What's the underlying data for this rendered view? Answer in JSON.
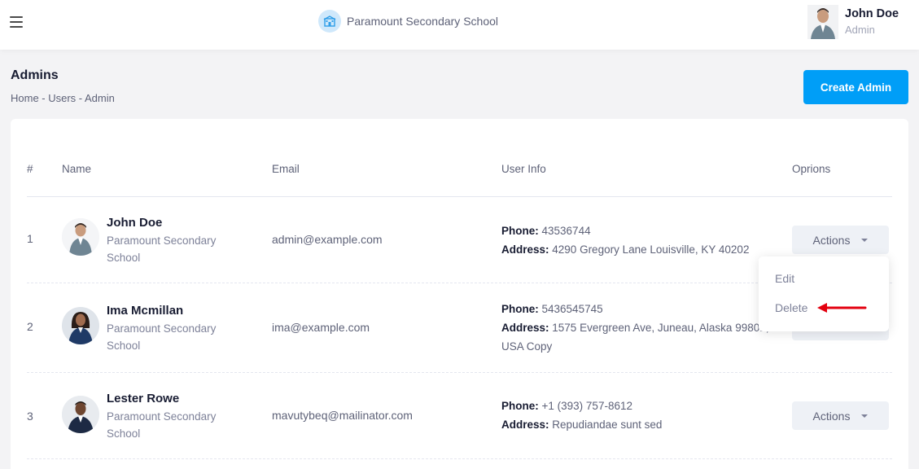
{
  "header": {
    "brand_name": "Paramount Secondary School",
    "user_name": "John Doe",
    "user_role": "Admin"
  },
  "page": {
    "title": "Admins",
    "breadcrumb": "Home - Users - Admin",
    "create_button": "Create Admin"
  },
  "table": {
    "headers": [
      "#",
      "Name",
      "Email",
      "User Info",
      "Oprions"
    ],
    "phone_label": "Phone:",
    "address_label": "Address:",
    "actions_label": "Actions",
    "rows": [
      {
        "index": "1",
        "name": "John Doe",
        "school": "Paramount Secondary School",
        "email": "admin@example.com",
        "phone": "43536744",
        "address": "4290 Gregory Lane Louisville, KY 40202"
      },
      {
        "index": "2",
        "name": "Ima Mcmillan",
        "school": "Paramount Secondary School",
        "email": "ima@example.com",
        "phone": "5436545745",
        "address": "1575 Evergreen Ave, Juneau, Alaska 99801, USA Copy"
      },
      {
        "index": "3",
        "name": "Lester Rowe",
        "school": "Paramount Secondary School",
        "email": "mavutybeq@mailinator.com",
        "phone": "+1 (393) 757-8612",
        "address": "Repudiandae sunt sed"
      }
    ]
  },
  "dropdown": {
    "items": [
      "Edit",
      "Delete"
    ]
  },
  "colors": {
    "primary": "#009ef7",
    "annotation_arrow": "#e3000f"
  }
}
